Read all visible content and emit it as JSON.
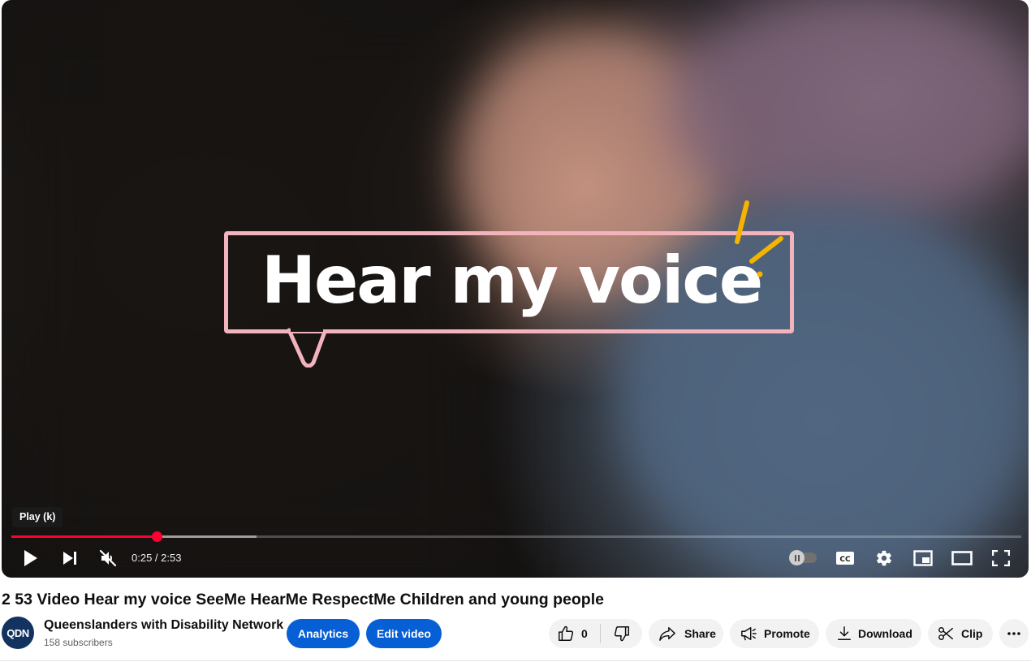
{
  "player": {
    "overlay_text": "Hear my voice",
    "tooltip": "Play (k)",
    "time": {
      "current": "0:25",
      "separator": " / ",
      "duration": "2:53"
    },
    "progress_played_fraction": 0.1445,
    "progress_buffered_fraction": 0.243,
    "controls": {
      "play": "play-icon",
      "next": "next-icon",
      "volume": "volume-muted-icon",
      "autoplay": "autoplay-toggle",
      "captions": "cc-icon",
      "settings": "gear-icon",
      "miniplayer": "miniplayer-icon",
      "theater": "theater-icon",
      "fullscreen": "fullscreen-icon"
    },
    "colors": {
      "progress": "#ff0033",
      "overlay_border": "#f2b3bd",
      "spark": "#f4b400"
    }
  },
  "video": {
    "title": "2 53 Video Hear my voice SeeMe HearMe RespectMe Children and young people"
  },
  "channel": {
    "avatar_text": "QDN",
    "name": "Queenslanders with Disability Network",
    "subscribers": "158 subscribers"
  },
  "actions": {
    "analytics": "Analytics",
    "edit_video": "Edit video",
    "like_count": "0",
    "share": "Share",
    "promote": "Promote",
    "download": "Download",
    "clip": "Clip",
    "accent_color": "#065fd4"
  }
}
